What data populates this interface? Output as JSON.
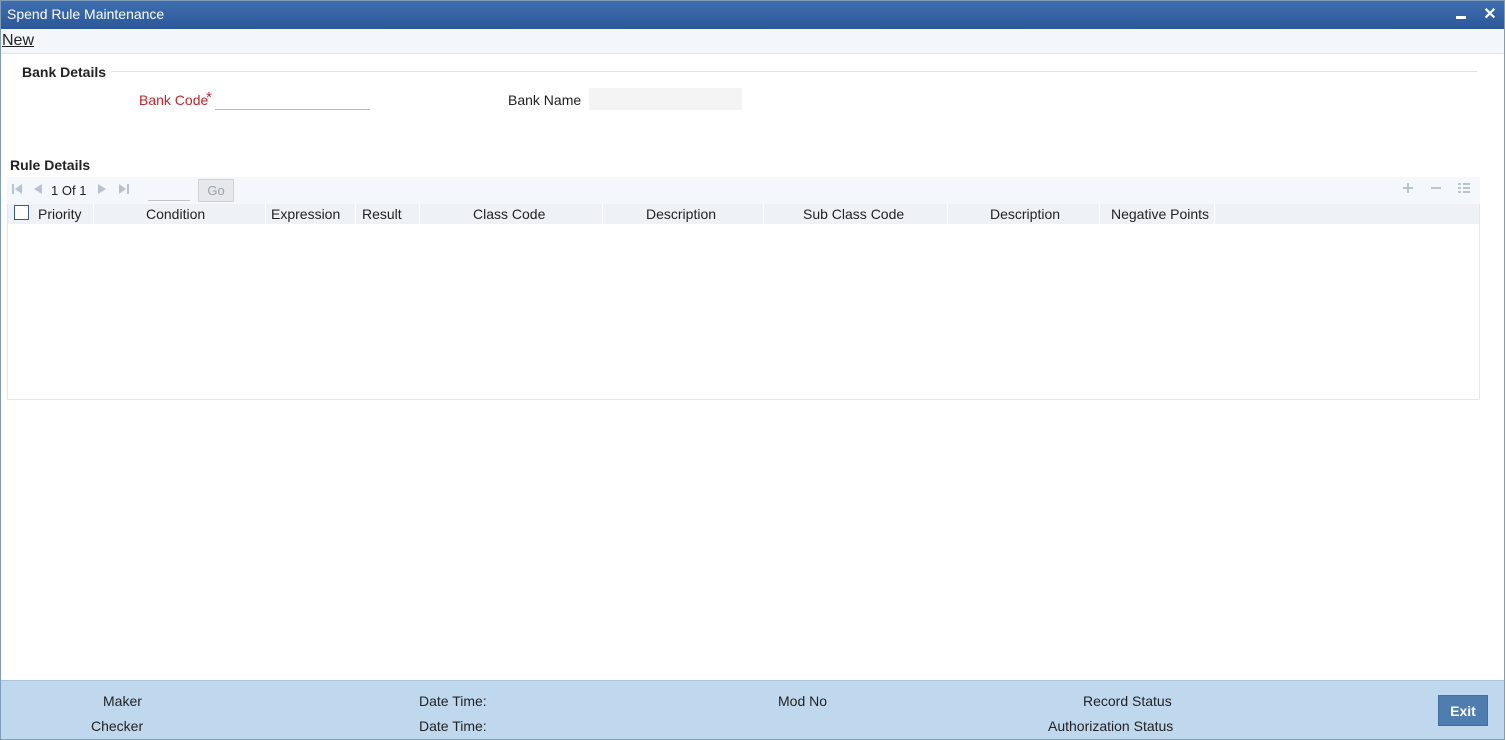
{
  "window": {
    "title": "Spend Rule Maintenance",
    "minimize_glyph": "",
    "close_glyph": "✕"
  },
  "menu": {
    "new_label": "New"
  },
  "bank_details": {
    "title": "Bank Details",
    "bank_code_label": "Bank Code",
    "required_mark": "*",
    "bank_code_value": "",
    "bank_name_label": "Bank Name",
    "bank_name_value": ""
  },
  "rule_details": {
    "title": "Rule Details",
    "pagination": {
      "current_page": "1",
      "of_label": "Of",
      "total_pages": "1",
      "page_input_value": "",
      "go_label": "Go"
    },
    "columns": [
      "Priority",
      "Condition",
      "Expression",
      "Result",
      "Class Code",
      "Description",
      "Sub Class Code",
      "Description",
      "Negative Points"
    ],
    "rows": []
  },
  "icons": {
    "first": "first-page-icon",
    "prev": "previous-page-icon",
    "next": "next-page-icon",
    "last": "last-page-icon",
    "add": "add-row-icon",
    "remove": "delete-row-icon",
    "list": "single-view-icon"
  },
  "footer": {
    "maker_label": "Maker",
    "checker_label": "Checker",
    "date_time_label_1": "Date Time:",
    "date_time_label_2": "Date Time:",
    "mod_no_label": "Mod No",
    "record_status_label": "Record Status",
    "authorization_status_label": "Authorization Status",
    "exit_label": "Exit"
  },
  "colors": {
    "title_bar": "#2b5797",
    "required_label": "#c0272d",
    "footer_bg": "#c0d8ee",
    "exit_button": "#4f7db0"
  }
}
